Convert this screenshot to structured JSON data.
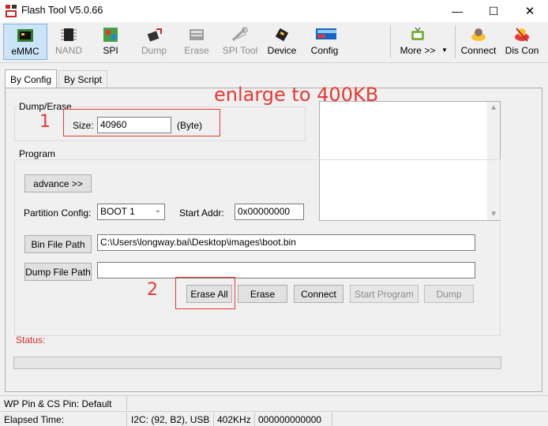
{
  "window": {
    "title": "Flash Tool V5.0.66",
    "minimize": "—",
    "maximize": "☐",
    "close": "✕"
  },
  "toolbar": {
    "items": [
      {
        "label": "eMMC",
        "icon": "emmc-chip-icon",
        "selected": true,
        "enabled": true
      },
      {
        "label": "NAND",
        "icon": "nand-chip-icon",
        "enabled": false
      },
      {
        "label": "SPI",
        "icon": "spi-board-icon",
        "enabled": true
      },
      {
        "label": "Dump",
        "icon": "dump-icon",
        "enabled": false
      },
      {
        "label": "Erase",
        "icon": "erase-icon",
        "enabled": false
      },
      {
        "label": "SPI Tool",
        "icon": "spi-tool-icon",
        "enabled": false
      },
      {
        "label": "Device",
        "icon": "device-icon",
        "enabled": true
      },
      {
        "label": "Config",
        "icon": "config-icon",
        "enabled": true
      },
      {
        "label": "More >>",
        "icon": "tv-icon",
        "enabled": true
      },
      {
        "label": "Connect",
        "icon": "connect-icon",
        "enabled": true
      },
      {
        "label": "Dis Con",
        "icon": "disconnect-icon",
        "enabled": true
      }
    ],
    "dropdown_arrow": "▼"
  },
  "tabs": [
    {
      "label": "By Config",
      "active": true
    },
    {
      "label": "By Script",
      "active": false
    }
  ],
  "dump_erase": {
    "title": "Dump/Erase",
    "size_label": "Size:",
    "size_value": "40960",
    "size_unit": "(Byte)"
  },
  "program": {
    "title": "Program",
    "advance_button": "advance >>",
    "partition_label": "Partition Config:",
    "partition_value": "BOOT 1",
    "start_addr_label": "Start Addr:",
    "start_addr_value": "0x00000000",
    "bin_file_button": "Bin File Path",
    "bin_file_value": "C:\\Users\\longway.bai\\Desktop\\images\\boot.bin",
    "dump_file_button": "Dump File Path",
    "dump_file_value": ""
  },
  "actions": {
    "erase_all": "Erase All",
    "erase": "Erase",
    "connect": "Connect",
    "start_program": "Start Program",
    "dump": "Dump"
  },
  "status": {
    "label": "Status:",
    "progress": 0
  },
  "annotations": {
    "note": "enlarge to 400KB",
    "marker1": "1",
    "marker2": "2",
    "color": "#e53935"
  },
  "statusbar": {
    "pins": "WP Pin & CS Pin: Default",
    "elapsed": "Elapsed Time:",
    "i2c": "I2C: (92, B2), USB",
    "freq": "402KHz",
    "code": "000000000000"
  }
}
